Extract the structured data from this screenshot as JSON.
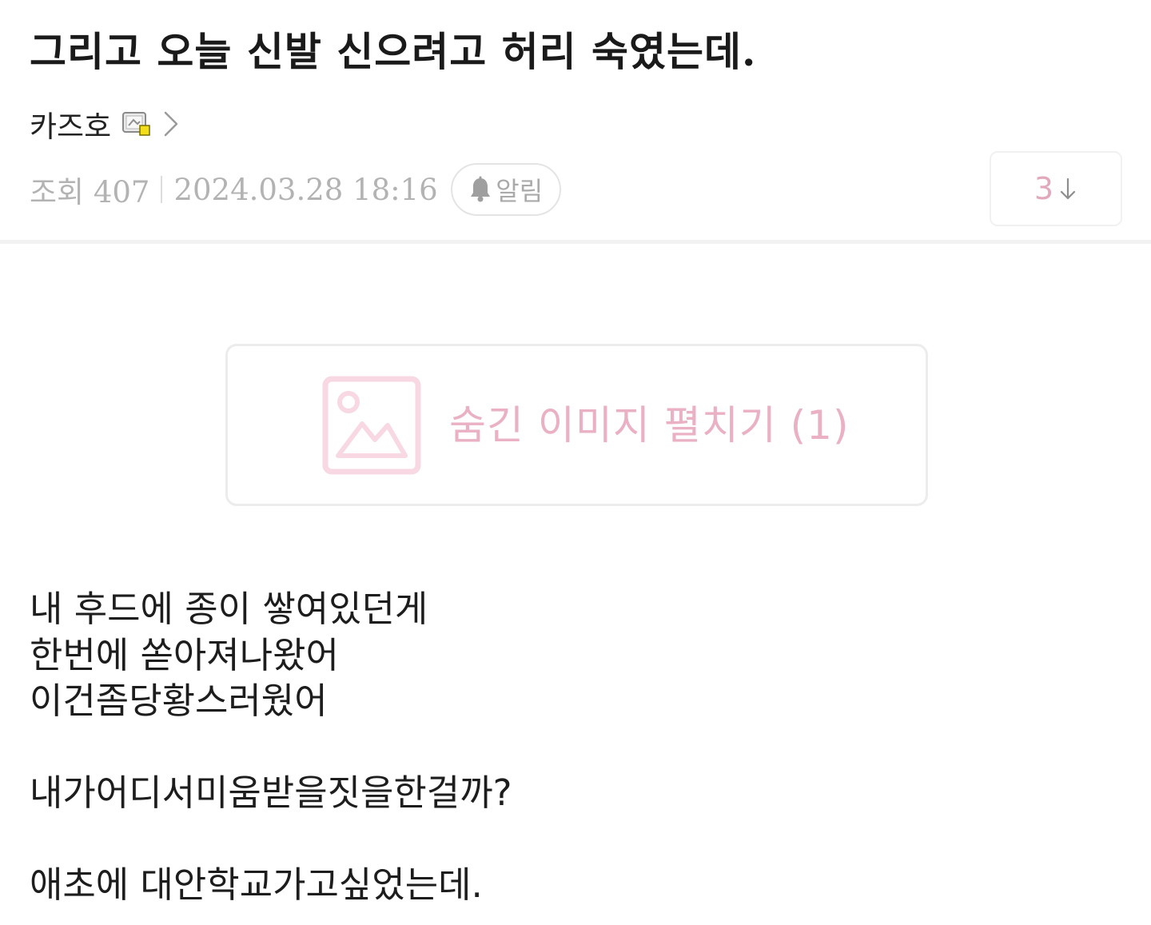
{
  "post": {
    "title": "그리고 오늘 신발 신으려고 허리 숙였는데.",
    "author": "카즈호",
    "views_label": "조회 407",
    "date": "2024.03.28 18:16",
    "alarm_label": "알림",
    "comment_count": "3"
  },
  "hidden_image": {
    "label": "숨긴 이미지 펼치기 (1)"
  },
  "body": {
    "line1": "내 후드에 종이 쌓여있던게",
    "line2": "한번에 쏟아져나왔어",
    "line3": "이건좀당황스러웠어",
    "line4": "내가어디서미움받을짓을한걸까?",
    "line5": "애초에 대안학교가고싶었는데."
  },
  "colors": {
    "accent_pink": "#eab0c3",
    "muted_text": "#b3b3b3",
    "border": "#ececec"
  },
  "icons": {
    "level": "level-badge-icon",
    "chevron": "chevron-right-icon",
    "bell": "bell-icon",
    "arrow": "arrow-down-icon",
    "image": "image-placeholder-icon"
  }
}
